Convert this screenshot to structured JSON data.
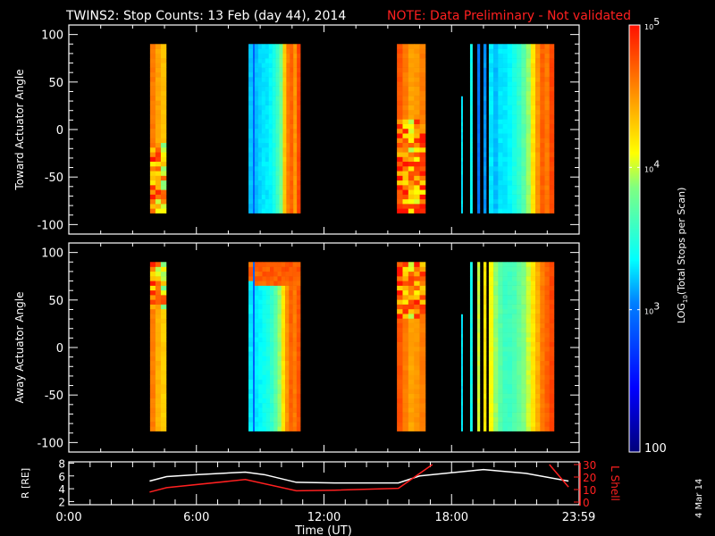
{
  "title": "TWINS2: Stop Counts: 13 Feb (day  44), 2014",
  "note": "NOTE: Data Preliminary - Not validated",
  "colors": {
    "note": "#ff2020",
    "lshell": "#ff2020",
    "rtrace": "#ffffff",
    "frame": "#ffffff"
  },
  "side_label": "4 Mar 14",
  "chart_data": [
    {
      "type": "heatmap",
      "ylabel": "Toward Actuator Angle",
      "ylim": [
        -110,
        110
      ],
      "yticks": [
        "100",
        "50",
        "0",
        "-50",
        "-100"
      ],
      "ytick_values": [
        100,
        50,
        0,
        -50,
        -100
      ],
      "angle_range": [
        -88,
        90
      ],
      "xlim_hours": [
        0,
        24
      ],
      "segments": [
        {
          "start": 3.82,
          "end": 4.58,
          "levels": [
            4.6,
            4.45,
            4.35
          ],
          "mixed_below": -15
        },
        {
          "start": 8.45,
          "end": 8.66,
          "levels": [
            3.2
          ]
        },
        {
          "start": 8.66,
          "end": 8.74,
          "levels": [
            2.9
          ]
        },
        {
          "start": 8.74,
          "end": 10.89,
          "levels": [
            3.2,
            3.25,
            3.3,
            3.3,
            3.35,
            3.45,
            3.6,
            3.8,
            4.3,
            4.6,
            4.7,
            4.5,
            4.8
          ]
        },
        {
          "start": 15.43,
          "end": 16.77,
          "levels": [
            4.75,
            4.6,
            4.45,
            4.5,
            4.6
          ],
          "mixed_below": 10
        },
        {
          "start": 18.45,
          "end": 18.52,
          "levels": [
            3.3
          ],
          "top_angle": 35
        },
        {
          "start": 18.87,
          "end": 18.98,
          "levels": [
            3.4
          ]
        },
        {
          "start": 19.21,
          "end": 19.33,
          "levels": [
            3.0
          ]
        },
        {
          "start": 19.5,
          "end": 19.63,
          "levels": [
            3.1
          ]
        },
        {
          "start": 19.75,
          "end": 22.82,
          "levels": [
            3.3,
            3.2,
            3.3,
            3.3,
            3.35,
            3.45,
            3.55,
            3.7,
            3.9,
            4.2,
            4.5,
            4.7,
            4.6,
            4.8
          ]
        }
      ]
    },
    {
      "type": "heatmap",
      "ylabel": "Away Actuator Angle",
      "ylim": [
        -110,
        110
      ],
      "yticks": [
        "100",
        "50",
        "0",
        "-50",
        "-100"
      ],
      "ytick_values": [
        100,
        50,
        0,
        -50,
        -100
      ],
      "angle_range": [
        -88,
        90
      ],
      "xlim_hours": [
        0,
        24
      ],
      "segments": [
        {
          "start": 3.82,
          "end": 4.58,
          "levels": [
            4.6,
            4.4,
            4.3
          ],
          "mixed_above": 40
        },
        {
          "start": 8.45,
          "end": 8.66,
          "levels": [
            3.3
          ],
          "top_level": 4.7,
          "top_from": 70
        },
        {
          "start": 8.66,
          "end": 8.74,
          "levels": [
            2.9
          ]
        },
        {
          "start": 8.74,
          "end": 10.89,
          "levels": [
            3.3,
            3.35,
            3.4,
            3.45,
            3.55,
            3.7,
            3.9,
            4.2,
            4.5,
            4.7,
            4.6,
            4.75
          ],
          "top_level": 4.7,
          "top_from": 65
        },
        {
          "start": 15.43,
          "end": 16.77,
          "levels": [
            4.75,
            4.6,
            4.45,
            4.5,
            4.6
          ],
          "mixed_above": 30
        },
        {
          "start": 18.45,
          "end": 18.52,
          "levels": [
            3.3
          ],
          "top_angle": 35
        },
        {
          "start": 18.87,
          "end": 18.98,
          "levels": [
            3.4
          ]
        },
        {
          "start": 19.21,
          "end": 19.33,
          "levels": [
            4.0
          ]
        },
        {
          "start": 19.5,
          "end": 19.63,
          "levels": [
            4.2
          ]
        },
        {
          "start": 19.75,
          "end": 22.82,
          "levels": [
            4.1,
            3.9,
            3.7,
            3.6,
            3.6,
            3.65,
            3.75,
            3.85,
            4.0,
            4.2,
            4.4,
            4.6,
            4.7,
            4.8
          ]
        }
      ]
    },
    {
      "type": "line",
      "xlabel": "Time (UT)",
      "xticks": [
        "0:00",
        "6:00",
        "12:00",
        "18:00",
        "23:59"
      ],
      "xtick_hours": [
        0,
        6,
        12,
        18,
        23.98
      ],
      "ylabel_left": "R [RE]",
      "ylim_left": [
        1.5,
        8.2
      ],
      "yticks_left": [
        "8",
        "6",
        "4",
        "2"
      ],
      "ylabel_right": "L Shell",
      "ylim_right": [
        0,
        30
      ],
      "yticks_right": [
        "30",
        "20",
        "10",
        "0"
      ],
      "series": [
        {
          "axis": "left",
          "x": [
            3.8,
            4.6,
            6,
            8.3,
            9.2,
            10.7,
            12.5,
            15.5,
            16.5,
            19.5,
            21.5,
            23.5
          ],
          "y": [
            5.2,
            5.9,
            6.2,
            6.6,
            6.2,
            5.0,
            4.9,
            4.9,
            6.0,
            7.0,
            6.4,
            5.2
          ]
        },
        {
          "axis": "right",
          "x": [
            3.8,
            4.6,
            8.3,
            10.7,
            12.5,
            15.5,
            17.1,
            22.6,
            23.5
          ],
          "y": [
            8,
            11.5,
            18,
            9,
            9.5,
            11,
            30,
            30,
            12
          ],
          "gap_between": [
            17.1,
            22.6
          ]
        }
      ]
    },
    {
      "type": "colorbar",
      "label": "LOG10(Total Stops per Scan)",
      "label_main": "LOG",
      "label_sub": "10",
      "label_rest": "(Total Stops per Scan)",
      "range_log10": [
        2,
        5
      ],
      "ticks": [
        {
          "base": "10",
          "exp": "5",
          "value": 5
        },
        {
          "base": "10",
          "exp": "4",
          "value": 4
        },
        {
          "base": "10",
          "exp": "3",
          "value": 3
        },
        {
          "base": "100",
          "exp": "",
          "value": 2
        }
      ]
    }
  ]
}
